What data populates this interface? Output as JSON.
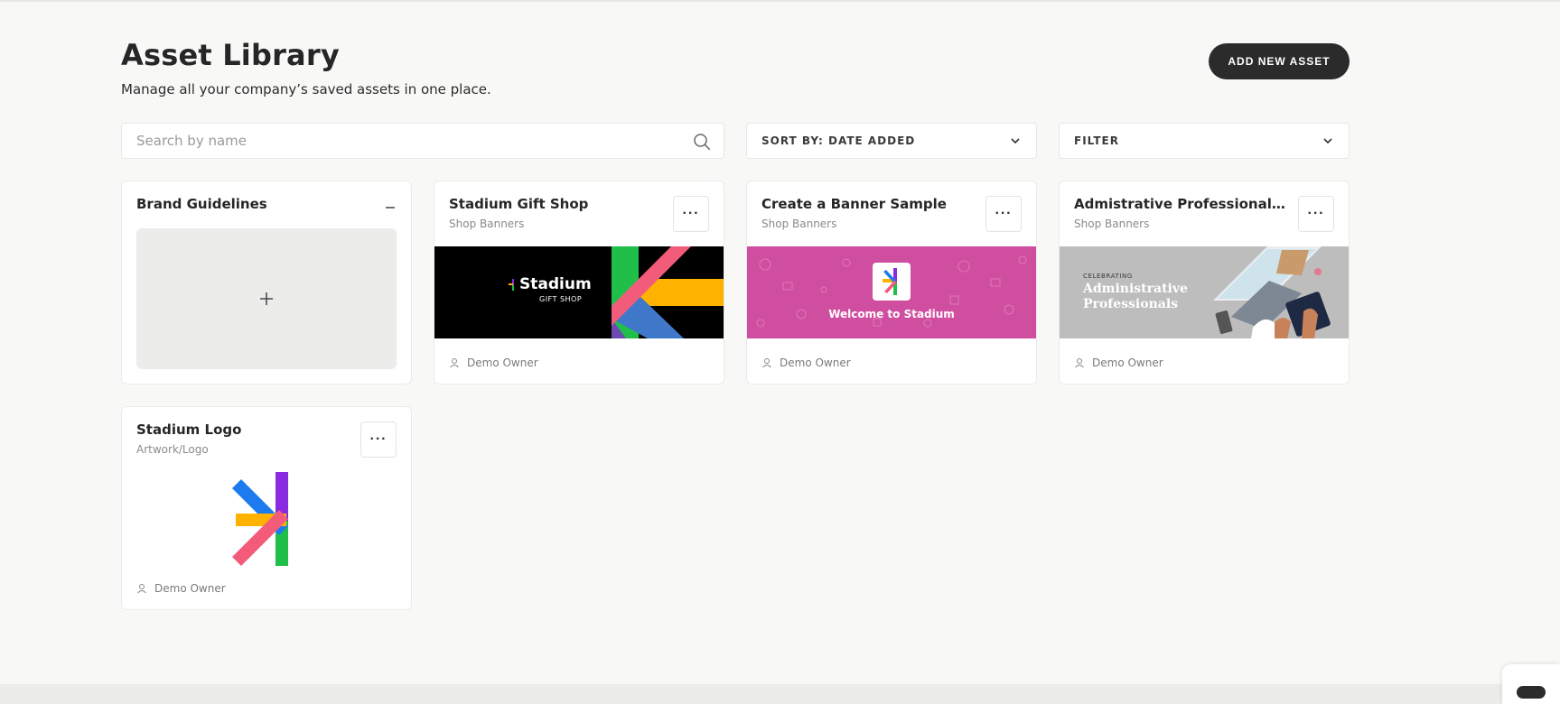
{
  "header": {
    "title": "Asset Library",
    "subtitle": "Manage all your company’s saved assets in one place.",
    "add_button": "ADD NEW ASSET"
  },
  "search": {
    "placeholder": "Search by name",
    "icon": "search-icon"
  },
  "sort": {
    "label": "SORT BY: DATE ADDED",
    "icon": "chevron-down-icon"
  },
  "filter": {
    "label": "FILTER",
    "icon": "chevron-down-icon"
  },
  "brand_guidelines": {
    "title": "Brand Guidelines",
    "add_icon": "plus-icon",
    "collapse_icon": "minus-icon"
  },
  "assets": [
    {
      "title": "Stadium Gift Shop",
      "category": "Shop Banners",
      "owner": "Demo Owner",
      "menu": "···",
      "thumb_text": "Stadium",
      "thumb_subtext": "GIFT SHOP"
    },
    {
      "title": "Create a Banner Sample",
      "category": "Shop Banners",
      "owner": "Demo Owner",
      "menu": "···",
      "thumb_text": "Welcome to Stadium"
    },
    {
      "title": "Admistrative Professionals C...",
      "category": "Shop Banners",
      "owner": "Demo Owner",
      "menu": "···",
      "thumb_kicker": "CELEBRATING",
      "thumb_line1": "Administrative",
      "thumb_line2": "Professionals"
    },
    {
      "title": "Stadium Logo",
      "category": "Artwork/Logo",
      "owner": "Demo Owner",
      "menu": "···"
    }
  ],
  "colors": {
    "brand_purple": "#8a2be2",
    "brand_blue": "#1e7bef",
    "brand_yellow": "#ffb300",
    "brand_pink": "#f25c7a",
    "brand_green": "#1fbf4a",
    "banner_magenta": "#d04ea0",
    "dark": "#2b2b2b"
  }
}
